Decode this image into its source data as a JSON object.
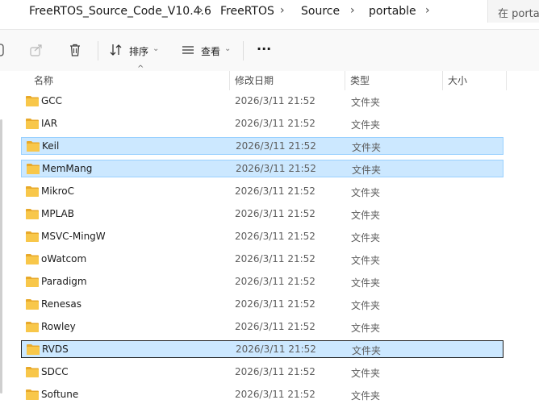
{
  "address": {
    "crumbs": [
      "FreeRTOS_Source_Code_V10.4.6",
      "FreeRTOS",
      "Source",
      "portable"
    ],
    "search_placeholder": "在 porta"
  },
  "toolbar": {
    "sort_label": "排序",
    "view_label": "查看",
    "more_label": "···"
  },
  "columns": {
    "name": "名称",
    "date": "修改日期",
    "type": "类型",
    "size": "大小"
  },
  "rows": [
    {
      "name": "GCC",
      "date": "2026/3/11 21:52",
      "type": "文件夹"
    },
    {
      "name": "IAR",
      "date": "2026/3/11 21:52",
      "type": "文件夹"
    },
    {
      "name": "Keil",
      "date": "2026/3/11 21:52",
      "type": "文件夹"
    },
    {
      "name": "MemMang",
      "date": "2026/3/11 21:52",
      "type": "文件夹"
    },
    {
      "name": "MikroC",
      "date": "2026/3/11 21:52",
      "type": "文件夹"
    },
    {
      "name": "MPLAB",
      "date": "2026/3/11 21:52",
      "type": "文件夹"
    },
    {
      "name": "MSVC-MingW",
      "date": "2026/3/11 21:52",
      "type": "文件夹"
    },
    {
      "name": "oWatcom",
      "date": "2026/3/11 21:52",
      "type": "文件夹"
    },
    {
      "name": "Paradigm",
      "date": "2026/3/11 21:52",
      "type": "文件夹"
    },
    {
      "name": "Renesas",
      "date": "2026/3/11 21:52",
      "type": "文件夹"
    },
    {
      "name": "Rowley",
      "date": "2026/3/11 21:52",
      "type": "文件夹"
    },
    {
      "name": "RVDS",
      "date": "2026/3/11 21:52",
      "type": "文件夹"
    },
    {
      "name": "SDCC",
      "date": "2026/3/11 21:52",
      "type": "文件夹"
    },
    {
      "name": "Softune",
      "date": "2026/3/11 21:52",
      "type": "文件夹"
    }
  ],
  "colors": {
    "selection_bg": "#cce8ff",
    "selection_border": "#99d1ff",
    "folder": "#f8c74a"
  }
}
